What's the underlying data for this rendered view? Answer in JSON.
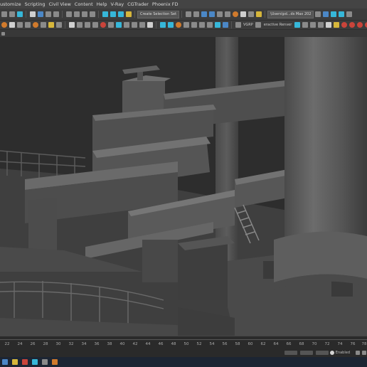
{
  "menu": {
    "items": [
      "ustomize",
      "Scripting",
      "Civil View",
      "Content",
      "Help",
      "V-Ray",
      "CGTrader",
      "Phoenix FD"
    ]
  },
  "toolbar": {
    "selection_set_label": "Create Selection Set",
    "workspace_label": "\\Users\\pd...ds Max 202",
    "vray_label": "VGRP",
    "interactive_label": "eractive Renver"
  },
  "timeline": {
    "ticks": [
      "22",
      "24",
      "26",
      "28",
      "30",
      "32",
      "34",
      "36",
      "38",
      "40",
      "42",
      "44",
      "46",
      "48",
      "50",
      "52",
      "54",
      "56",
      "58",
      "60",
      "62",
      "64",
      "66",
      "68",
      "70",
      "72",
      "74",
      "76",
      "78"
    ]
  },
  "status": {
    "enabled_label": "Enabled"
  },
  "colors": {
    "accent_orange": "#d07a2c",
    "accent_blue": "#4b87c6",
    "accent_cyan": "#36b7d9",
    "viewport_bg": "#2d2d2d",
    "taskbar_bg": "#1c2533"
  }
}
